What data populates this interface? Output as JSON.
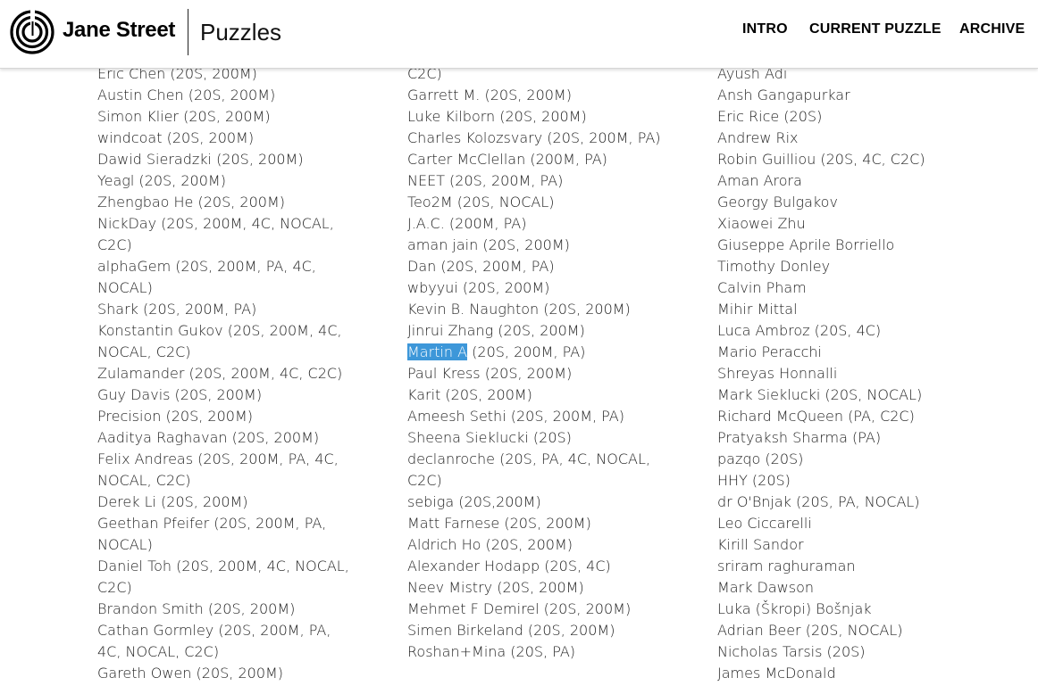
{
  "header": {
    "brand": "Jane Street",
    "section": "Puzzles",
    "nav": [
      "INTRO",
      "CURRENT PUZZLE",
      "ARCHIVE"
    ]
  },
  "colors": {
    "highlight": "#3d97d9",
    "text": "#222222"
  },
  "columns": [
    [
      "Eric Chen (20S, 200M)",
      "Austin Chen (20S, 200M)",
      "Simon Klier (20S, 200M)",
      "windcoat (20S, 200M)",
      "Dawid Sieradzki (20S, 200M)",
      "Yeagl (20S, 200M)",
      "Zhengbao He (20S, 200M)",
      "NickDay (20S, 200M, 4C, NOCAL, C2C)",
      "alphaGem (20S, 200M, PA, 4C, NOCAL)",
      "Shark (20S, 200M, PA)",
      "Konstantin Gukov (20S, 200M, 4C, NOCAL, C2C)",
      "Zulamander (20S, 200M, 4C, C2C)",
      "Guy Davis (20S, 200M)",
      "Precision (20S, 200M)",
      "Aaditya Raghavan (20S, 200M)",
      "Felix Andreas (20S, 200M, PA, 4C, NOCAL, C2C)",
      "Derek Li (20S, 200M)",
      "Geethan Pfeifer (20S, 200M, PA, NOCAL)",
      "Daniel Toh (20S, 200M, 4C, NOCAL, C2C)",
      "Brandon Smith (20S, 200M)",
      "Cathan Gormley (20S, 200M, PA, 4C, NOCAL, C2C)",
      "Gareth Owen (20S, 200M)"
    ],
    [
      "C2C)",
      "Garrett M. (20S, 200M)",
      "Luke Kilborn (20S, 200M)",
      "Charles Kolozsvary (20S, 200M, PA)",
      "Carter McClellan (200M, PA)",
      "NEET (20S, 200M, PA)",
      "Teo2M (20S, NOCAL)",
      "J.A.C. (200M, PA)",
      "aman jain (20S, 200M)",
      "Dan (20S, 200M, PA)",
      "wbyyui (20S, 200M)",
      "Kevin B. Naughton (20S, 200M)",
      "Jinrui Zhang (20S, 200M)",
      "Martin A (20S, 200M, PA)",
      "Paul Kress (20S, 200M)",
      "Karit (20S, 200M)",
      "Ameesh Sethi (20S, 200M, PA)",
      "Sheena Sieklucki (20S)",
      "declanroche (20S, PA, 4C, NOCAL, C2C)",
      "sebiga (20S,200M)",
      "Matt Farnese (20S, 200M)",
      "Aldrich Ho (20S, 200M)",
      "Alexander Hodapp (20S, 4C)",
      "Neev Mistry (20S, 200M)",
      "Mehmet F Demirel (20S, 200M)",
      "Simen Birkeland (20S, 200M)",
      "Roshan+Mina (20S, PA)"
    ],
    [
      "Ayush Adi",
      "Ansh Gangapurkar",
      "Eric Rice (20S)",
      "Andrew Rix",
      "Robin Guilliou (20S, 4C, C2C)",
      "Aman Arora",
      "Georgy Bulgakov",
      "Xiaowei Zhu",
      "Giuseppe Aprile Borriello",
      "Timothy Donley",
      "Calvin Pham",
      "Mihir Mittal",
      "Luca Ambroz (20S, 4C)",
      "Mario Peracchi",
      "Shreyas Honnalli",
      "Mark Sieklucki (20S, NOCAL)",
      "Richard McQueen (PA, C2C)",
      "Pratyaksh Sharma (PA)",
      "pazqo (20S)",
      "HHY (20S)",
      "dr O'Bnjak (20S, PA, NOCAL)",
      "Leo Ciccarelli",
      "Kirill Sandor",
      "sriram raghuraman",
      "Mark Dawson",
      "Luka (Škropi) Bošnjak",
      "Adrian Beer (20S, NOCAL)",
      "Nicholas Tarsis (20S)",
      "James McDonald"
    ]
  ],
  "highlighted": {
    "column": 1,
    "index": 13,
    "text": "Martin A"
  }
}
